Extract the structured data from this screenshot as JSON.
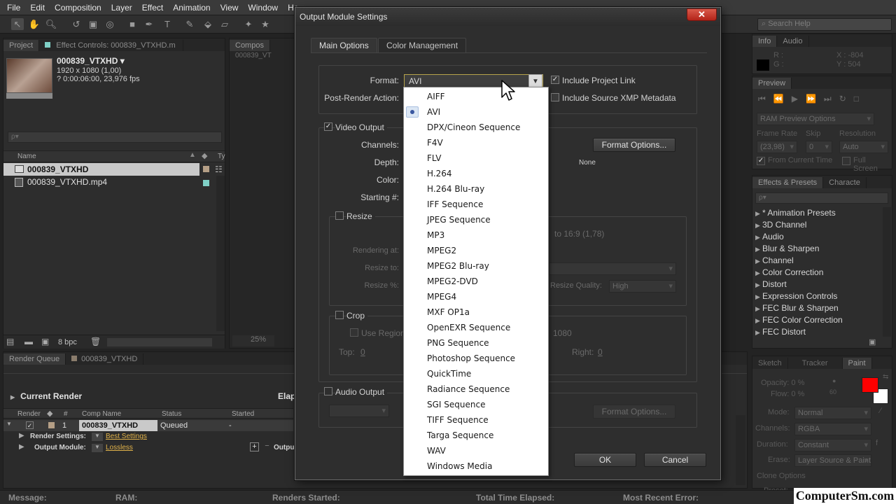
{
  "menu": [
    "File",
    "Edit",
    "Composition",
    "Layer",
    "Effect",
    "Animation",
    "View",
    "Window",
    "He"
  ],
  "search_help": "Search Help",
  "project_panel": {
    "tabs": [
      "Project",
      "Effect Controls: 000839_VTXHD.m"
    ],
    "clip_name": "000839_VTXHD ▾",
    "clip_size": "1920 x 1080 (1,00)",
    "clip_duration": "? 0:00:06:00, 23,976 fps",
    "search_placeholder": "ρ▾",
    "col_name": "Name",
    "col_type": "Ty",
    "items": [
      "000839_VTXHD",
      "000839_VTXHD.mp4"
    ],
    "bpc": "8 bpc"
  },
  "comp_panel": {
    "tab": "Compos",
    "subtab": "000839_VT",
    "zoom": "25%"
  },
  "render_queue": {
    "tabs": [
      "Render Queue",
      "000839_VTXHD"
    ],
    "current_render": "Current Render",
    "elapsed": "Elap",
    "columns": [
      "Render",
      "#",
      "Comp Name",
      "Status",
      "Started"
    ],
    "row": {
      "num": "1",
      "comp": "000839_VTXHD",
      "status": "Queued",
      "started": "-"
    },
    "render_settings_label": "Render Settings:",
    "render_settings_value": "Best Settings",
    "output_module_label": "Output Module:",
    "output_module_value": "Lossless",
    "output_to": "Outpu"
  },
  "info_panel": {
    "tabs": [
      "Info",
      "Audio"
    ],
    "r": "R :",
    "g": "G :",
    "x": "X : -804",
    "y": "Y : 504"
  },
  "preview_panel": {
    "tab": "Preview",
    "ram_options": "RAM Preview Options",
    "frame_rate_label": "Frame Rate",
    "skip_label": "Skip",
    "resolution_label": "Resolution",
    "frame_rate": "(23,98)",
    "skip": "0",
    "resolution": "Auto",
    "from_current": "From Current Time",
    "full_screen": "Full Screen"
  },
  "effects_panel": {
    "tabs": [
      "Effects & Presets",
      "Characte"
    ],
    "search_placeholder": "ρ▾",
    "items": [
      "* Animation Presets",
      "3D Channel",
      "Audio",
      "Blur & Sharpen",
      "Channel",
      "Color Correction",
      "Distort",
      "Expression Controls",
      "FEC Blur & Sharpen",
      "FEC Color Correction",
      "FEC Distort"
    ]
  },
  "paint_panel": {
    "tabs": [
      "Sketch",
      "Tracker",
      "Paint"
    ],
    "opacity": "Opacity: 0 %",
    "flow": "Flow: 0 %",
    "brush_size": "60",
    "mode_label": "Mode:",
    "mode": "Normal",
    "channels_label": "Channels:",
    "channels": "RGBA",
    "duration_label": "Duration:",
    "duration": "Constant",
    "erase_label": "Erase:",
    "erase": "Layer Source & Paint",
    "clone_options": "Clone Options",
    "preset_label": "Preset:",
    "fg_color": "#ff0000",
    "bg_color": "#ffffff"
  },
  "statusbar": {
    "message": "Message:",
    "ram": "RAM:",
    "renders_started": "Renders Started:",
    "total_time": "Total Time Elapsed:",
    "recent_error": "Most Recent Error:"
  },
  "watermark": "ComputerSm.com",
  "dialog": {
    "title": "Output Module Settings",
    "close": "✕",
    "tabs": [
      "Main Options",
      "Color Management"
    ],
    "format_label": "Format:",
    "format_value": "AVI",
    "post_render_label": "Post-Render Action:",
    "include_project_link": "Include Project Link",
    "include_xmp": "Include Source XMP Metadata",
    "video_output": "Video Output",
    "channels_label": "Channels:",
    "depth_label": "Depth:",
    "color_label": "Color:",
    "starting_label": "Starting #:",
    "format_options": "Format Options...",
    "none_text": "None",
    "resize": "Resize",
    "aspect_text": "to 16:9 (1,78)",
    "rendering_at": "Rendering at:",
    "resize_to": "Resize to:",
    "resize_pct": "Resize %:",
    "resize_quality_label": "Resize Quality:",
    "resize_quality": "High",
    "crop": "Crop",
    "use_region": "Use Region",
    "crop_size": "1080",
    "top_label": "Top:",
    "top_value": "0",
    "right_label": "Right:",
    "right_value": "0",
    "audio_output": "Audio Output",
    "audio_format_options": "Format Options...",
    "ok": "OK",
    "cancel": "Cancel"
  },
  "format_options_list": [
    "AIFF",
    "AVI",
    "DPX/Cineon Sequence",
    "F4V",
    "FLV",
    "H.264",
    "H.264 Blu-ray",
    "IFF Sequence",
    "JPEG Sequence",
    "MP3",
    "MPEG2",
    "MPEG2 Blu-ray",
    "MPEG2-DVD",
    "MPEG4",
    "MXF OP1a",
    "OpenEXR Sequence",
    "PNG Sequence",
    "Photoshop Sequence",
    "QuickTime",
    "Radiance Sequence",
    "SGI Sequence",
    "TIFF Sequence",
    "Targa Sequence",
    "WAV",
    "Windows Media"
  ],
  "format_selected": "AVI"
}
